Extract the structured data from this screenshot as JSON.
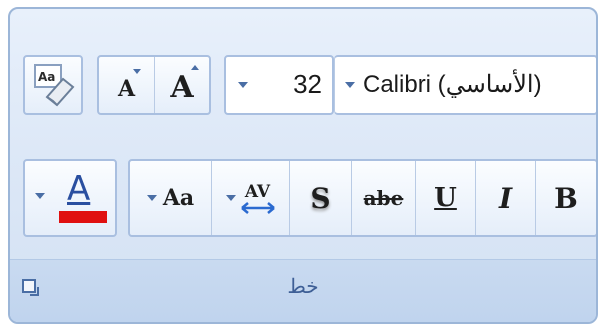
{
  "font_group": {
    "label": "خط",
    "font_name": "Calibri (الأساسي)",
    "font_size": "32",
    "buttons": {
      "grow_font": "A",
      "shrink_font": "A",
      "clear_formatting_glyph": "Aa",
      "font_color_glyph": "A",
      "change_case_glyph": "Aa",
      "spacing_glyph": "AV",
      "shadow_glyph": "S",
      "strikethrough_glyph": "abe",
      "underline_glyph": "U",
      "italic_glyph": "I",
      "bold_glyph": "B"
    },
    "font_color_hex": "#e01010",
    "accent_hex": "#4a6ea5"
  }
}
